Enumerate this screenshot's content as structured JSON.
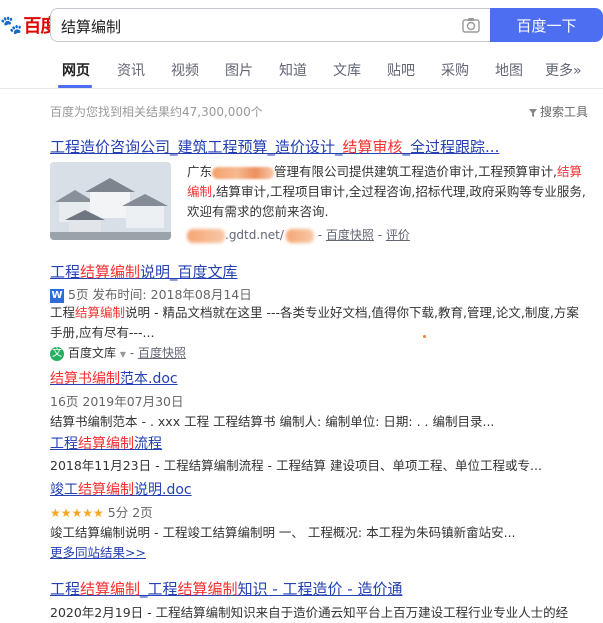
{
  "logo": {
    "text": "百度",
    "brand_color": "#e10602",
    "accent": "#2932e1"
  },
  "search": {
    "value": "结算编制",
    "button": "百度一下",
    "button_color": "#4e6ef2"
  },
  "nav": {
    "tabs": [
      "网页",
      "资讯",
      "视频",
      "图片",
      "知道",
      "文库",
      "贴吧",
      "采购",
      "地图",
      "更多»"
    ]
  },
  "stats": {
    "text": "百度为您找到相关结果约47,300,000个",
    "tools": "搜索工具"
  },
  "results": [
    {
      "title_parts": [
        "工程造价咨询公司_建筑工程预算_造价设计_",
        "结算审核",
        "_全过程跟踪..."
      ],
      "desc_prefix": "广东",
      "desc_lines": [
        "管理有限公司提供建筑工程造价审计,工程预算审计,",
        "结算编制",
        ",结算审计,工程项目审计,全过程咨询,招标代理,政府采购等专业",
        "服务,欢迎有需求的您前来咨询."
      ],
      "url_suffix": ".gdtd.net/",
      "snapshot": "百度快照",
      "review": "评价"
    },
    {
      "title_parts": [
        "工程",
        "结算编制",
        "说明_百度文库"
      ],
      "meta": "5页 发布时间: 2018年08月14日",
      "desc_parts": [
        "工程",
        "结算编制",
        "说明 - 精品文档就在这里 ---各类专业好文档,值得你下载,教育,管理,论文,制度,方",
        "案手册,应有尽有---..."
      ],
      "source": "百度文库",
      "snapshot": "百度快照"
    }
  ],
  "sub_results": [
    {
      "title_parts": [
        "结算书",
        "编制",
        "范本.doc"
      ],
      "meta": "16页 2019年07月30日",
      "desc": "结算书编制范本 - . xxx 工程 工程结算书 编制人: 编制单位: 日期: . . 编制目录..."
    },
    {
      "title_parts": [
        "工程",
        "结算编制",
        "流程"
      ],
      "desc": "2018年11月23日 - 工程结算编制流程 - 工程结算 建设项目、单项工程、单位工程或专..."
    },
    {
      "title_parts": [
        "竣工",
        "结算编制",
        "说明.doc"
      ],
      "meta_stars": "★★★★★",
      "meta": "5分 2页",
      "desc": "竣工结算编制说明 - 工程竣工结算编制明 一、 工程概况: 本工程为朱码镇新畲站安..."
    }
  ],
  "more_link": "更多同站结果>>",
  "last_result": {
    "title_parts": [
      "工程",
      "结算编制",
      "_工程",
      "结算编制",
      "知识 - 工程造价 - 造价通"
    ],
    "desc": "2020年2月19日 - 工程结算编制知识来自于造价通云知平台上百万建设工程行业专业人士的经"
  }
}
